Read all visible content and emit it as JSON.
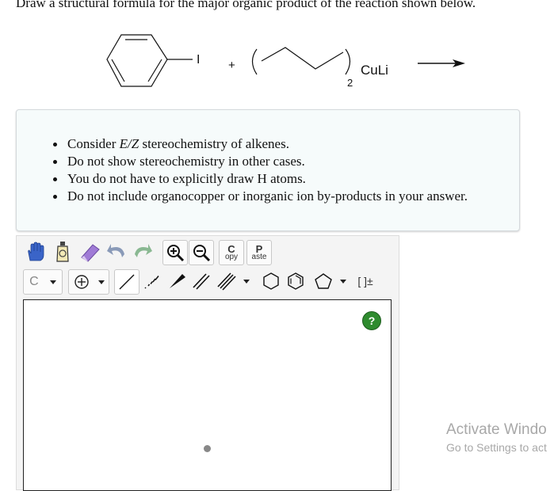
{
  "question": {
    "text": "Draw a structural formula for the major organic product of the reaction shown below."
  },
  "reaction": {
    "substituent": "I",
    "plus": "+",
    "subscript": "2",
    "reagent": "CuLi"
  },
  "instructions": {
    "items": [
      {
        "pre": "Consider ",
        "italic": "E/Z",
        "post": " stereochemistry of alkenes."
      },
      {
        "pre": "Do not show stereochemistry in other cases.",
        "italic": "",
        "post": ""
      },
      {
        "pre": "You do not have to explicitly draw H atoms.",
        "italic": "",
        "post": ""
      },
      {
        "pre": "Do not include organocopper or inorganic ion by-products in your answer.",
        "italic": "",
        "post": ""
      }
    ]
  },
  "editor": {
    "copy_big": "C",
    "copy_small": "opy",
    "paste_big": "P",
    "paste_small": "aste",
    "atom_label": "C",
    "bracket_label": "[ ]±",
    "help_label": "?"
  },
  "watermark": {
    "title": "Activate Windo",
    "subtitle": "Go to Settings to act"
  }
}
